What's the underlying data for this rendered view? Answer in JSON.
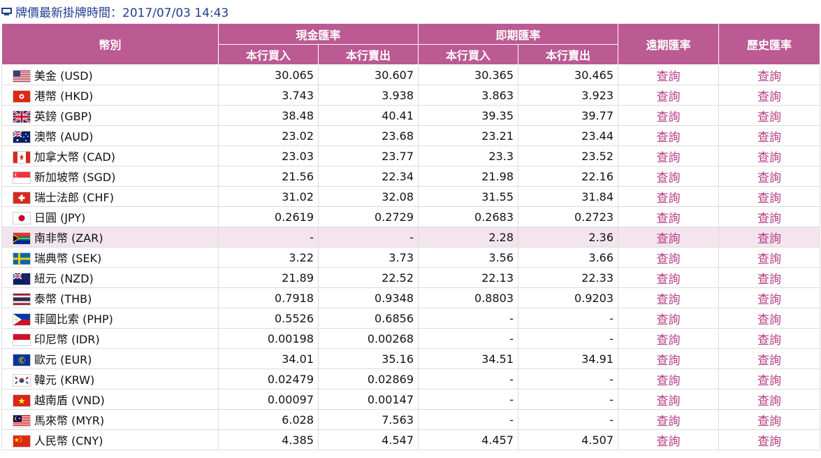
{
  "header": {
    "title": "牌價最新掛牌時間：2017/07/03 14:43",
    "icon": "monitor-icon"
  },
  "columns": {
    "currency": "幣別",
    "cash": "現金匯率",
    "spot": "即期匯率",
    "forward": "遠期匯率",
    "history": "歷史匯率",
    "buy": "本行買入",
    "sell": "本行賣出"
  },
  "rows": [
    {
      "name": "美金 (USD)",
      "code": "USD",
      "cash_buy": "30.065",
      "cash_sell": "30.607",
      "spot_buy": "30.365",
      "spot_sell": "30.465",
      "forward": "查詢",
      "history": "查詢"
    },
    {
      "name": "港幣 (HKD)",
      "code": "HKD",
      "cash_buy": "3.743",
      "cash_sell": "3.938",
      "spot_buy": "3.863",
      "spot_sell": "3.923",
      "forward": "查詢",
      "history": "查詢"
    },
    {
      "name": "英鎊 (GBP)",
      "code": "GBP",
      "cash_buy": "38.48",
      "cash_sell": "40.41",
      "spot_buy": "39.35",
      "spot_sell": "39.77",
      "forward": "查詢",
      "history": "查詢"
    },
    {
      "name": "澳幣 (AUD)",
      "code": "AUD",
      "cash_buy": "23.02",
      "cash_sell": "23.68",
      "spot_buy": "23.21",
      "spot_sell": "23.44",
      "forward": "查詢",
      "history": "查詢"
    },
    {
      "name": "加拿大幣 (CAD)",
      "code": "CAD",
      "cash_buy": "23.03",
      "cash_sell": "23.77",
      "spot_buy": "23.3",
      "spot_sell": "23.52",
      "forward": "查詢",
      "history": "查詢"
    },
    {
      "name": "新加坡幣 (SGD)",
      "code": "SGD",
      "cash_buy": "21.56",
      "cash_sell": "22.34",
      "spot_buy": "21.98",
      "spot_sell": "22.16",
      "forward": "查詢",
      "history": "查詢"
    },
    {
      "name": "瑞士法郎 (CHF)",
      "code": "CHF",
      "cash_buy": "31.02",
      "cash_sell": "32.08",
      "spot_buy": "31.55",
      "spot_sell": "31.84",
      "forward": "查詢",
      "history": "查詢"
    },
    {
      "name": "日圓 (JPY)",
      "code": "JPY",
      "cash_buy": "0.2619",
      "cash_sell": "0.2729",
      "spot_buy": "0.2683",
      "spot_sell": "0.2723",
      "forward": "查詢",
      "history": "查詢"
    },
    {
      "name": "南非幣 (ZAR)",
      "code": "ZAR",
      "cash_buy": "-",
      "cash_sell": "-",
      "spot_buy": "2.28",
      "spot_sell": "2.36",
      "forward": "查詢",
      "history": "查詢",
      "highlighted": true
    },
    {
      "name": "瑞典幣 (SEK)",
      "code": "SEK",
      "cash_buy": "3.22",
      "cash_sell": "3.73",
      "spot_buy": "3.56",
      "spot_sell": "3.66",
      "forward": "查詢",
      "history": "查詢"
    },
    {
      "name": "紐元 (NZD)",
      "code": "NZD",
      "cash_buy": "21.89",
      "cash_sell": "22.52",
      "spot_buy": "22.13",
      "spot_sell": "22.33",
      "forward": "查詢",
      "history": "查詢"
    },
    {
      "name": "泰幣 (THB)",
      "code": "THB",
      "cash_buy": "0.7918",
      "cash_sell": "0.9348",
      "spot_buy": "0.8803",
      "spot_sell": "0.9203",
      "forward": "查詢",
      "history": "查詢"
    },
    {
      "name": "菲國比索 (PHP)",
      "code": "PHP",
      "cash_buy": "0.5526",
      "cash_sell": "0.6856",
      "spot_buy": "-",
      "spot_sell": "-",
      "forward": "查詢",
      "history": "查詢"
    },
    {
      "name": "印尼幣 (IDR)",
      "code": "IDR",
      "cash_buy": "0.00198",
      "cash_sell": "0.00268",
      "spot_buy": "-",
      "spot_sell": "-",
      "forward": "查詢",
      "history": "查詢"
    },
    {
      "name": "歐元 (EUR)",
      "code": "EUR",
      "cash_buy": "34.01",
      "cash_sell": "35.16",
      "spot_buy": "34.51",
      "spot_sell": "34.91",
      "forward": "查詢",
      "history": "查詢"
    },
    {
      "name": "韓元 (KRW)",
      "code": "KRW",
      "cash_buy": "0.02479",
      "cash_sell": "0.02869",
      "spot_buy": "-",
      "spot_sell": "-",
      "forward": "查詢",
      "history": "查詢"
    },
    {
      "name": "越南盾 (VND)",
      "code": "VND",
      "cash_buy": "0.00097",
      "cash_sell": "0.00147",
      "spot_buy": "-",
      "spot_sell": "-",
      "forward": "查詢",
      "history": "查詢"
    },
    {
      "name": "馬來幣 (MYR)",
      "code": "MYR",
      "cash_buy": "6.028",
      "cash_sell": "7.563",
      "spot_buy": "-",
      "spot_sell": "-",
      "forward": "查詢",
      "history": "查詢"
    },
    {
      "name": "人民幣 (CNY)",
      "code": "CNY",
      "cash_buy": "4.385",
      "cash_sell": "4.547",
      "spot_buy": "4.457",
      "spot_sell": "4.507",
      "forward": "查詢",
      "history": "查詢"
    }
  ],
  "colors": {
    "header_bg": "#bb5a93",
    "link": "#b43c82",
    "title": "#1f3f8f",
    "highlight_row": "#f3e4ee"
  }
}
